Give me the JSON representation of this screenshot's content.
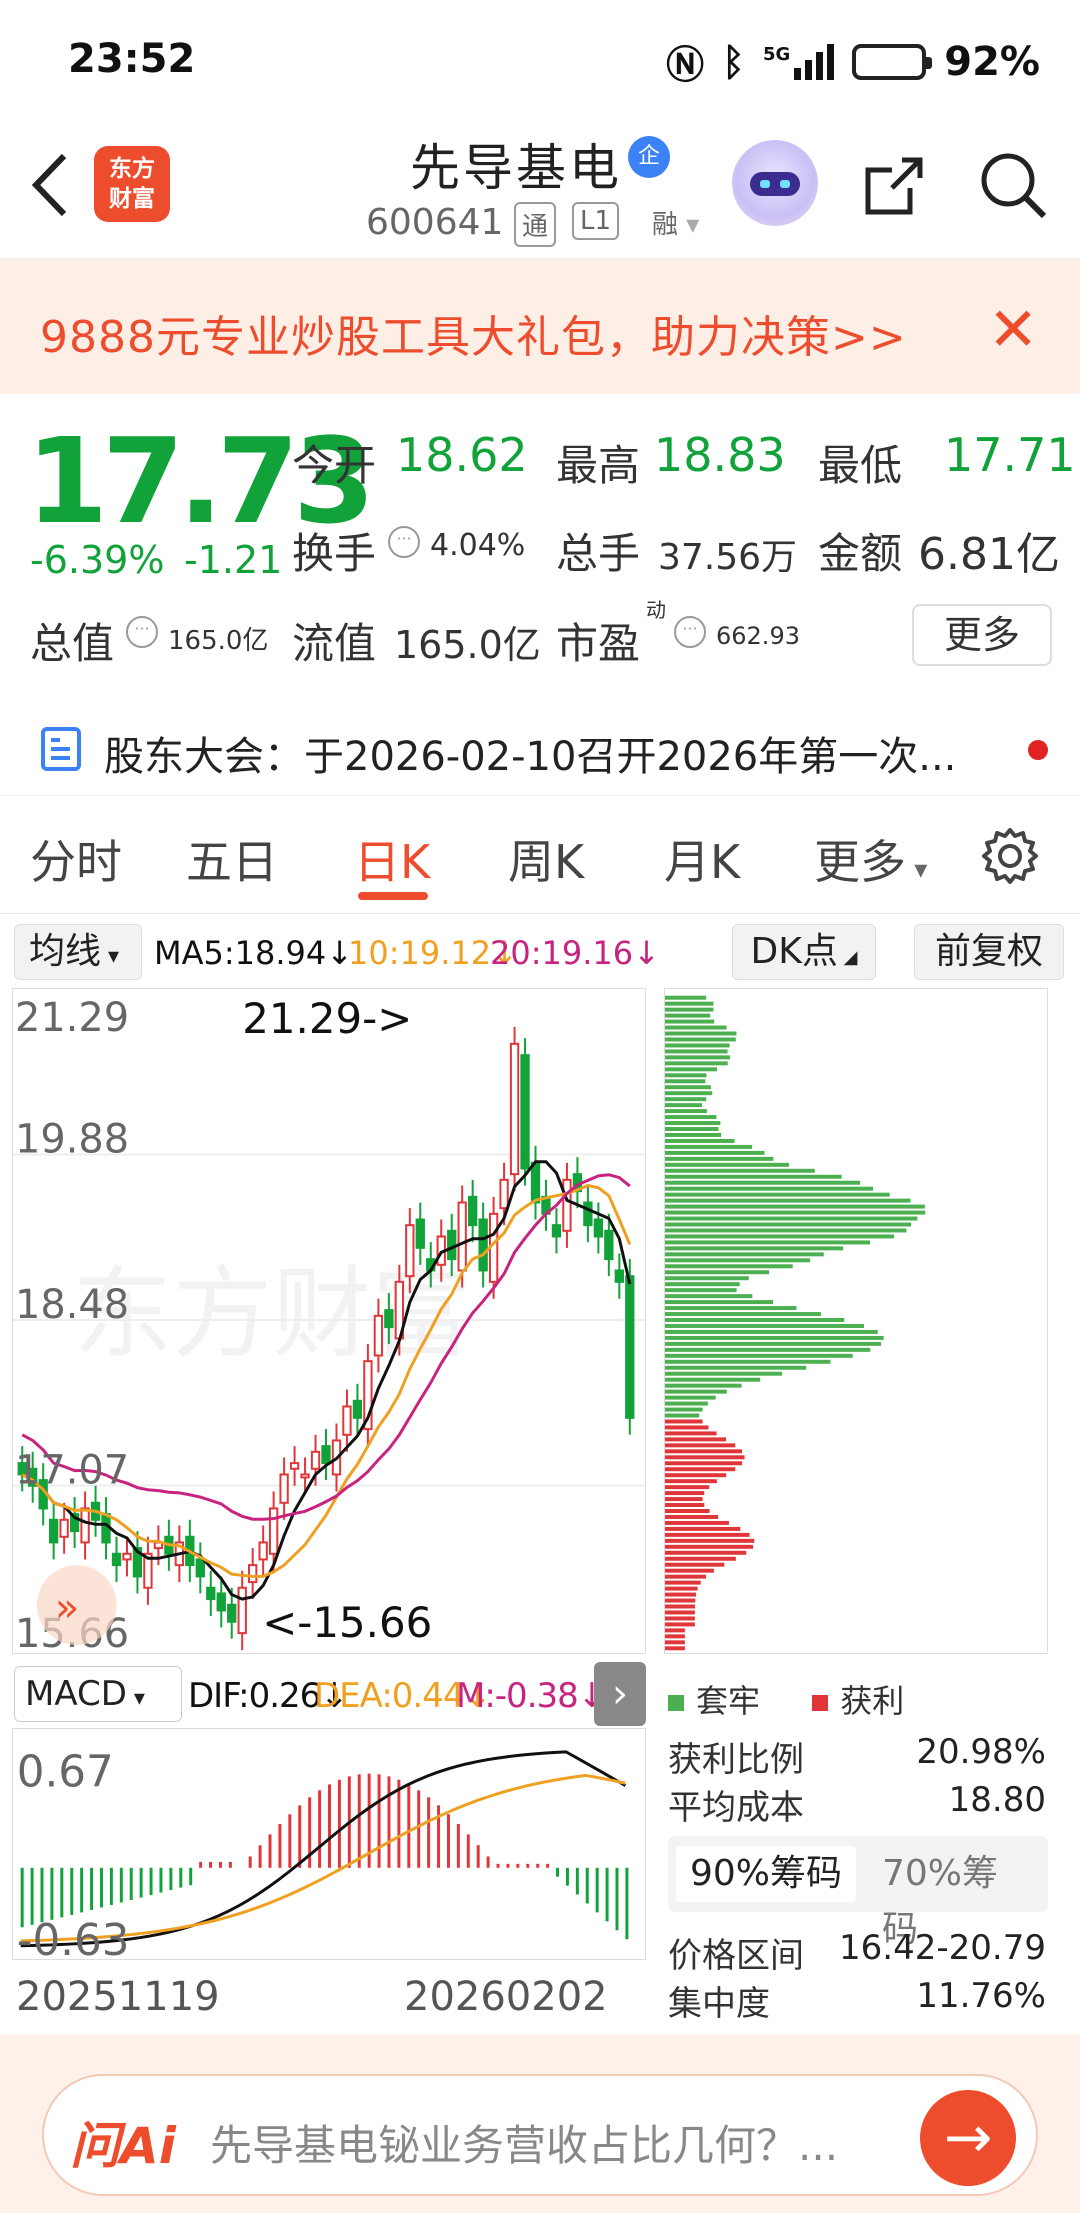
{
  "status_bar": {
    "time": "23:52",
    "network": "5G",
    "battery": "92%"
  },
  "header": {
    "back_glyph": "‹",
    "logo_text_1": "东方",
    "logo_text_2": "财富",
    "stock_name": "先导基电",
    "badge": "企",
    "stock_code": "600641",
    "tag_1": "通",
    "tag_2": "L1",
    "tag_3": "融"
  },
  "promo": {
    "text": "9888元专业炒股工具大礼包，助力决策>>",
    "close": "✕"
  },
  "quote": {
    "price": "17.73",
    "change_pct": "-6.39%",
    "change_abs": "-1.21",
    "open_label": "今开",
    "open": "18.62",
    "high_label": "最高",
    "high": "18.83",
    "low_label": "最低",
    "low": "17.71",
    "turnover_label": "换手",
    "turnover": "4.04%",
    "volume_label": "总手",
    "volume": "37.56万",
    "amount_label": "金额",
    "amount": "6.81亿",
    "total_mv_label": "总值",
    "total_mv": "165.0亿",
    "float_mv_label": "流值",
    "float_mv": "165.0亿",
    "pe_label": "市盈",
    "pe_sup": "动",
    "pe": "662.93",
    "more_button": "更多"
  },
  "notice": {
    "text": "股东大会：于2026-02-10召开2026年第一次..."
  },
  "tabs": [
    "分时",
    "五日",
    "日K",
    "周K",
    "月K",
    "更多"
  ],
  "active_tab": "日K",
  "ma_bar": {
    "select": "均线",
    "ma5": "MA5:18.94↓",
    "ma10": "10:19.12↓",
    "ma20": "20:19.16↓",
    "dk_button": "DK点",
    "adjust_button": "前复权"
  },
  "colors": {
    "up": "#e0363a",
    "down": "#12a23a",
    "ma5": "#111111",
    "ma10": "#f0a020",
    "ma20": "#c8237f",
    "accent": "#ee4d2d"
  },
  "kline": {
    "y_labels": [
      "21.29",
      "19.88",
      "18.48",
      "17.07",
      "15.66"
    ],
    "max_marker": "21.29->",
    "min_marker": "<-15.66",
    "watermark": "东方财富"
  },
  "macd_bar": {
    "select": "MACD",
    "dif": "DIF:0.26↓",
    "dea": "DEA:0.44↓",
    "m": "M:-0.38↓",
    "arrow": "›"
  },
  "macd_chart": {
    "y_top": "0.67",
    "y_bottom": "-0.63"
  },
  "dates": {
    "start": "20251119",
    "end": "20260202"
  },
  "chips": {
    "legend_trapped": "套牢",
    "legend_profit": "获利",
    "profit_ratio_label": "获利比例",
    "profit_ratio": "20.98%",
    "avg_cost_label": "平均成本",
    "avg_cost": "18.80",
    "tab_90": "90%筹码",
    "tab_70": "70%筹码",
    "range_label": "价格区间",
    "range": "16.42-20.79",
    "concentration_label": "集中度",
    "concentration": "11.76%"
  },
  "ask_bar": {
    "logo": "问Ai",
    "placeholder": "先导基电铋业务营收占比几何？...",
    "go": "→"
  }
}
